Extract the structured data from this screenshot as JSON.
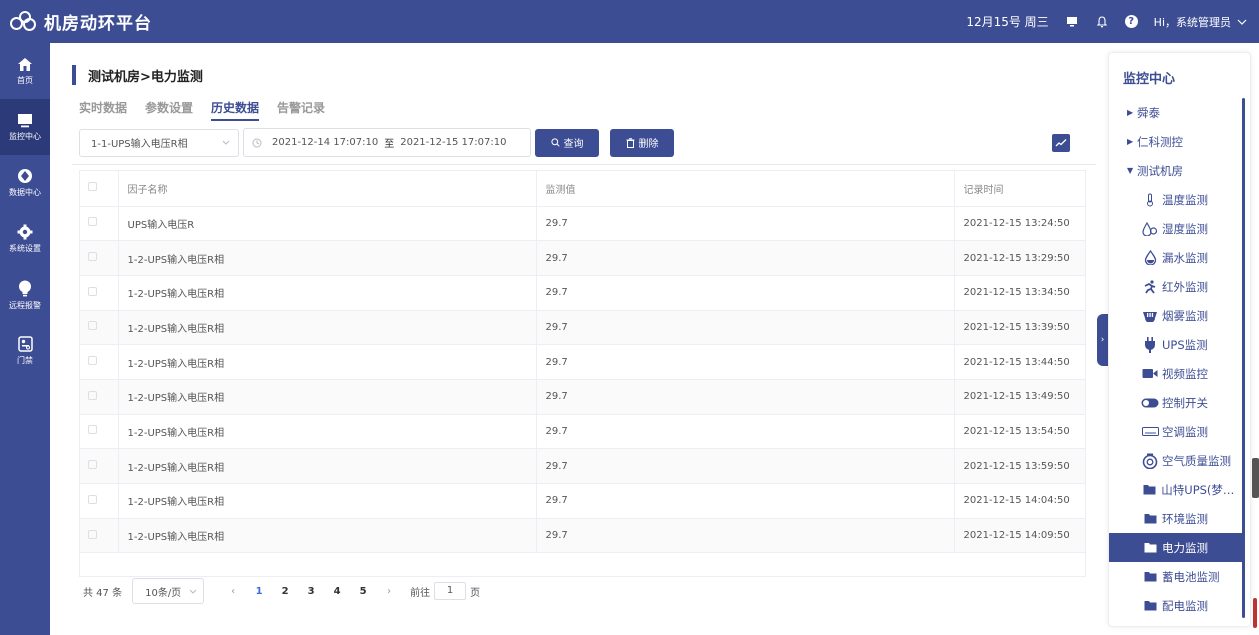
{
  "topbar": {
    "title": "机房动环平台",
    "date": "12月15号 周三",
    "user": "Hi，系统管理员"
  },
  "leftnav": [
    {
      "label": "首页",
      "icon": "home-icon"
    },
    {
      "label": "监控中心",
      "icon": "monitor-icon"
    },
    {
      "label": "数据中心",
      "icon": "data-icon"
    },
    {
      "label": "系统设置",
      "icon": "gear-icon"
    },
    {
      "label": "远程报警",
      "icon": "bulb-icon"
    },
    {
      "label": "门禁",
      "icon": "access-icon"
    }
  ],
  "page": {
    "title": "测试机房>电力监测",
    "tabs": [
      "实时数据",
      "参数设置",
      "历史数据",
      "告警记录"
    ],
    "active_tab": "历史数据"
  },
  "filters": {
    "factor_select": "1-1-UPS输入电压R相",
    "date_start": "2021-12-14 17:07:10",
    "date_sep": "至",
    "date_end": "2021-12-15 17:07:10",
    "query_label": "查询",
    "delete_label": "删除"
  },
  "table": {
    "headers": [
      "因子名称",
      "监测值",
      "记录时间"
    ],
    "rows": [
      [
        "UPS输入电压R",
        "29.7",
        "2021-12-15 13:24:50"
      ],
      [
        "1-2-UPS输入电压R相",
        "29.7",
        "2021-12-15 13:29:50"
      ],
      [
        "1-2-UPS输入电压R相",
        "29.7",
        "2021-12-15 13:34:50"
      ],
      [
        "1-2-UPS输入电压R相",
        "29.7",
        "2021-12-15 13:39:50"
      ],
      [
        "1-2-UPS输入电压R相",
        "29.7",
        "2021-12-15 13:44:50"
      ],
      [
        "1-2-UPS输入电压R相",
        "29.7",
        "2021-12-15 13:49:50"
      ],
      [
        "1-2-UPS输入电压R相",
        "29.7",
        "2021-12-15 13:54:50"
      ],
      [
        "1-2-UPS输入电压R相",
        "29.7",
        "2021-12-15 13:59:50"
      ],
      [
        "1-2-UPS输入电压R相",
        "29.7",
        "2021-12-15 14:04:50"
      ],
      [
        "1-2-UPS输入电压R相",
        "29.7",
        "2021-12-15 14:09:50"
      ]
    ]
  },
  "pager": {
    "total": "共 47 条",
    "page_size": "10条/页",
    "pages": [
      "1",
      "2",
      "3",
      "4",
      "5"
    ],
    "current": "1",
    "goto_prefix": "前往",
    "goto_value": "1",
    "goto_suffix": "页"
  },
  "rightpanel": {
    "title": "监控中心",
    "tree": [
      {
        "label": "舜泰",
        "type": "group",
        "expanded": false
      },
      {
        "label": "仁科测控",
        "type": "group",
        "expanded": false
      },
      {
        "label": "测试机房",
        "type": "group",
        "expanded": true
      },
      {
        "label": "温度监测",
        "type": "child",
        "icon": "thermometer-icon"
      },
      {
        "label": "湿度监测",
        "type": "child",
        "icon": "humidity-icon"
      },
      {
        "label": "漏水监测",
        "type": "child",
        "icon": "water-drop-icon"
      },
      {
        "label": "红外监测",
        "type": "child",
        "icon": "running-person-icon"
      },
      {
        "label": "烟雾监测",
        "type": "child",
        "icon": "smoke-detector-icon"
      },
      {
        "label": "UPS监测",
        "type": "child",
        "icon": "plug-icon"
      },
      {
        "label": "视频监控",
        "type": "child",
        "icon": "video-camera-icon"
      },
      {
        "label": "控制开关",
        "type": "child",
        "icon": "toggle-switch-icon"
      },
      {
        "label": "空调监测",
        "type": "child",
        "icon": "air-conditioner-icon"
      },
      {
        "label": "空气质量监测",
        "type": "child",
        "icon": "air-quality-icon"
      },
      {
        "label": "山特UPS(梦幻...",
        "type": "child",
        "icon": "folder-icon"
      },
      {
        "label": "环境监测",
        "type": "child",
        "icon": "folder-icon"
      },
      {
        "label": "电力监测",
        "type": "child",
        "icon": "folder-icon",
        "active": true
      },
      {
        "label": "蓄电池监测",
        "type": "child",
        "icon": "folder-icon"
      },
      {
        "label": "配电监测",
        "type": "child",
        "icon": "folder-icon"
      }
    ]
  },
  "colors": {
    "primary": "#3d4d94",
    "link_active": "#3d6ce0"
  }
}
